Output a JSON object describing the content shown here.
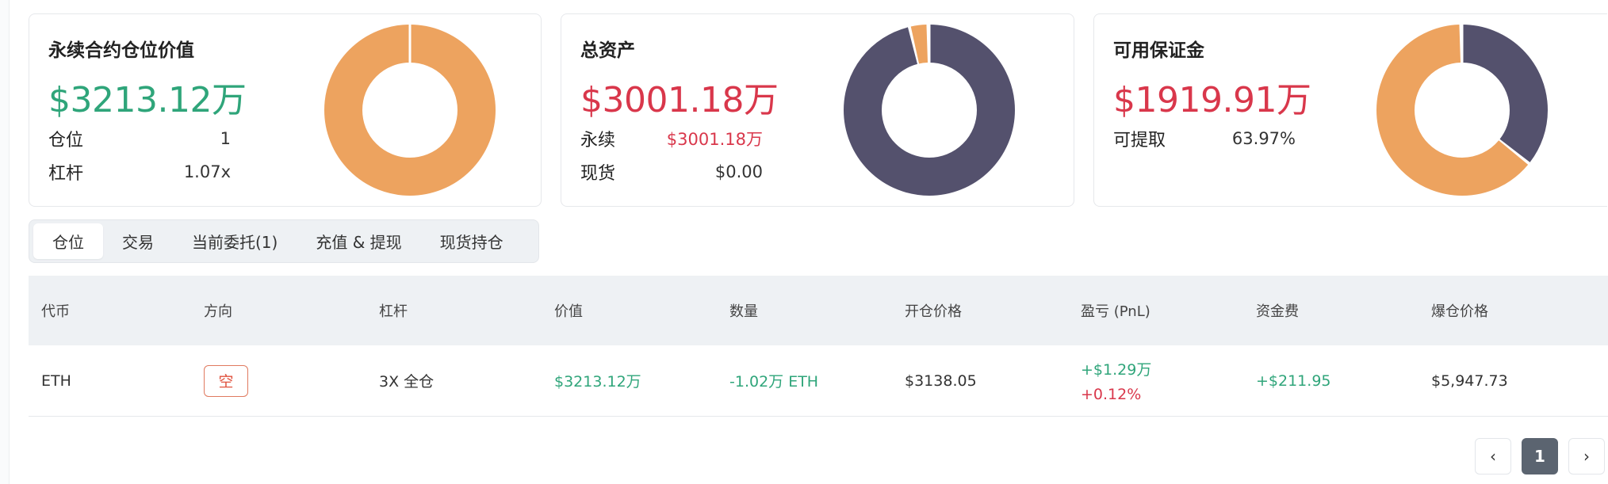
{
  "cards": [
    {
      "title": "永续合约仓位价值",
      "value": "$3213.12万",
      "value_color": "green",
      "rows": [
        {
          "label": "仓位",
          "value": "1"
        },
        {
          "label": "杠杆",
          "value": "1.07x"
        }
      ],
      "donut": {
        "segments": [
          {
            "fraction": 1.0,
            "color": "#eda35f"
          }
        ]
      }
    },
    {
      "title": "总资产",
      "value": "$3001.18万",
      "value_color": "red",
      "rows": [
        {
          "label": "永续",
          "value": "$3001.18万",
          "red": true
        },
        {
          "label": "现货",
          "value": "$0.00"
        }
      ],
      "donut": {
        "segments": [
          {
            "fraction": 0.965,
            "color": "#54516d"
          },
          {
            "fraction": 0.035,
            "color": "#eda35f"
          }
        ]
      }
    },
    {
      "title": "可用保证金",
      "value": "$1919.91万",
      "value_color": "red",
      "rows": [
        {
          "label": "可提取",
          "value": "63.97%"
        }
      ],
      "donut": {
        "segments": [
          {
            "fraction": 0.36,
            "color": "#54516d"
          },
          {
            "fraction": 0.64,
            "color": "#eda35f"
          }
        ]
      }
    }
  ],
  "tabs": [
    {
      "label": "仓位",
      "active": true
    },
    {
      "label": "交易",
      "active": false
    },
    {
      "label": "当前委托(1)",
      "active": false
    },
    {
      "label": "充值 & 提现",
      "active": false
    },
    {
      "label": "现货持仓",
      "active": false
    }
  ],
  "table": {
    "headers": [
      "代币",
      "方向",
      "杠杆",
      "价值",
      "数量",
      "开仓价格",
      "盈亏 (PnL)",
      "资金费",
      "爆仓价格"
    ],
    "rows": [
      {
        "token": "ETH",
        "side": "空",
        "leverage": "3X 全仓",
        "value": "$3213.12万",
        "quantity": "-1.02万 ETH",
        "entry_price": "$3138.05",
        "pnl_amount": "+$1.29万",
        "pnl_percent": "+0.12%",
        "funding": "+$211.95",
        "liq_price": "$5,947.73"
      }
    ]
  },
  "pagination": {
    "prev": "‹",
    "current": "1",
    "next": "›"
  },
  "colors": {
    "green": "#2fa57a",
    "red": "#d9374b",
    "orange": "#eda35f",
    "slate": "#54516d"
  }
}
